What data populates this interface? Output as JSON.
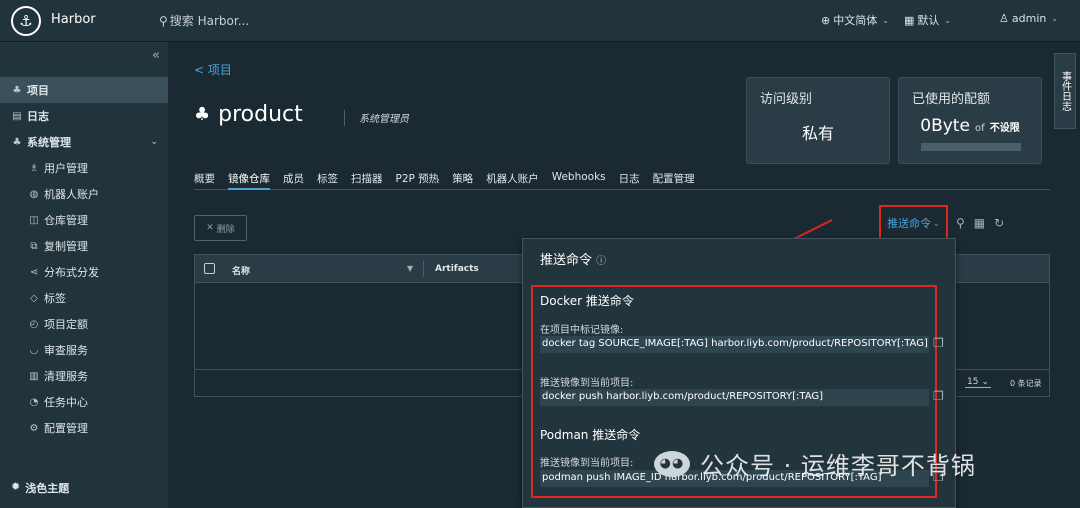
{
  "header": {
    "brand": "Harbor",
    "search_placeholder": "搜索 Harbor...",
    "language": "中文简体",
    "datetime": "默认",
    "user": "admin"
  },
  "sidebar": {
    "items": [
      {
        "label": "项目",
        "icon": "project-icon",
        "active": true
      },
      {
        "label": "日志",
        "icon": "log-icon"
      },
      {
        "label": "系统管理",
        "icon": "admin-icon"
      }
    ],
    "sub_items": [
      {
        "label": "用户管理",
        "icon": "users-icon"
      },
      {
        "label": "机器人账户",
        "icon": "robot-icon"
      },
      {
        "label": "仓库管理",
        "icon": "registry-icon"
      },
      {
        "label": "复制管理",
        "icon": "replication-icon"
      },
      {
        "label": "分布式分发",
        "icon": "distribution-icon"
      },
      {
        "label": "标签",
        "icon": "tag-icon"
      },
      {
        "label": "项目定额",
        "icon": "quota-icon"
      },
      {
        "label": "审查服务",
        "icon": "shield-icon"
      },
      {
        "label": "清理服务",
        "icon": "trash-icon"
      },
      {
        "label": "任务中心",
        "icon": "task-icon"
      },
      {
        "label": "配置管理",
        "icon": "gear-icon"
      }
    ],
    "theme": "浅色主题"
  },
  "main": {
    "back_link": "< 项目",
    "project_name": "product",
    "role": "系统管理员",
    "access_card": {
      "label": "访问级别",
      "value": "私有"
    },
    "quota_card": {
      "label": "已使用的配额",
      "used": "0Byte",
      "of": "of",
      "limit": "不设限"
    },
    "tabs": [
      "概要",
      "镜像仓库",
      "成员",
      "标签",
      "扫描器",
      "P2P 预热",
      "策略",
      "机器人账户",
      "Webhooks",
      "日志",
      "配置管理"
    ],
    "active_tab": "镜像仓库",
    "delete_button": "删除",
    "push_button": "推送命令",
    "table": {
      "columns": [
        "名称",
        "Artifacts"
      ],
      "page_size": "15",
      "count": "0 条记录"
    }
  },
  "push_popup": {
    "title": "推送命令",
    "docker": {
      "title": "Docker 推送命令",
      "tag_caption": "在项目中标记镜像:",
      "tag_cmd": "docker tag SOURCE_IMAGE[:TAG] harbor.liyb.com/product/REPOSITORY[:TAG]",
      "push_caption": "推送镜像到当前项目:",
      "push_cmd": "docker push harbor.liyb.com/product/REPOSITORY[:TAG]"
    },
    "podman": {
      "title": "Podman 推送命令",
      "push_caption": "推送镜像到当前项目:",
      "push_cmd": "podman push IMAGE_ID harbor.liyb.com/product/REPOSITORY[:TAG]"
    }
  },
  "event_log": "事件日志",
  "watermark": "公众号 · 运维李哥不背锅",
  "colors": {
    "accent": "#4aa4d8",
    "highlight": "#e0261e",
    "background": "#1b2a32"
  }
}
